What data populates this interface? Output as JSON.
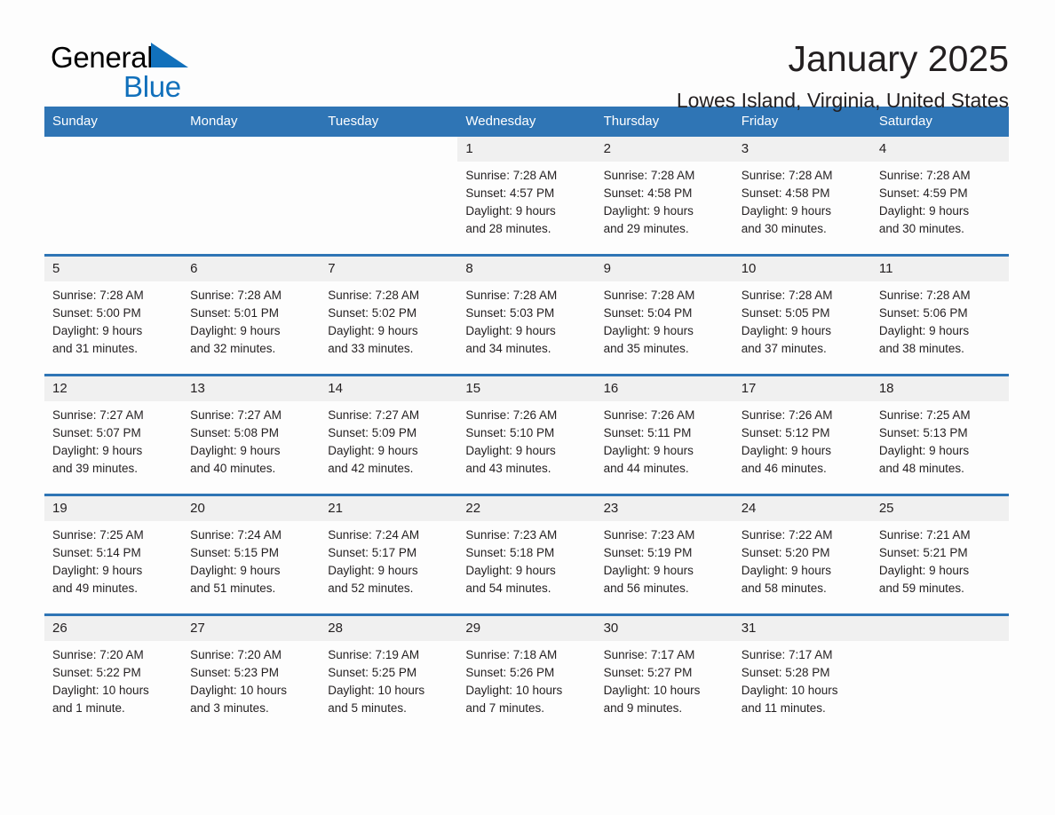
{
  "brand": {
    "name_part1": "General",
    "name_part2": "Blue",
    "triangle_color": "#1170bb",
    "blue_color": "#1170bb"
  },
  "header": {
    "title": "January 2025",
    "subtitle": "Lowes Island, Virginia, United States"
  },
  "theme": {
    "header_blue": "#2f75b5",
    "daynum_strip": "#f0f0f0",
    "page_background": "#fdfdfd",
    "text_color": "#231f20"
  },
  "weekday_headers": [
    "Sunday",
    "Monday",
    "Tuesday",
    "Wednesday",
    "Thursday",
    "Friday",
    "Saturday"
  ],
  "weeks": [
    [
      {
        "day": "",
        "blank": true,
        "void": true,
        "sunrise": "",
        "sunset": "",
        "daylight_line1": "",
        "daylight_line2": ""
      },
      {
        "day": "",
        "blank": true,
        "void": true,
        "sunrise": "",
        "sunset": "",
        "daylight_line1": "",
        "daylight_line2": ""
      },
      {
        "day": "",
        "blank": true,
        "void": true,
        "sunrise": "",
        "sunset": "",
        "daylight_line1": "",
        "daylight_line2": ""
      },
      {
        "day": "1",
        "sunrise": "Sunrise: 7:28 AM",
        "sunset": "Sunset: 4:57 PM",
        "daylight_line1": "Daylight: 9 hours",
        "daylight_line2": "and 28 minutes."
      },
      {
        "day": "2",
        "sunrise": "Sunrise: 7:28 AM",
        "sunset": "Sunset: 4:58 PM",
        "daylight_line1": "Daylight: 9 hours",
        "daylight_line2": "and 29 minutes."
      },
      {
        "day": "3",
        "sunrise": "Sunrise: 7:28 AM",
        "sunset": "Sunset: 4:58 PM",
        "daylight_line1": "Daylight: 9 hours",
        "daylight_line2": "and 30 minutes."
      },
      {
        "day": "4",
        "sunrise": "Sunrise: 7:28 AM",
        "sunset": "Sunset: 4:59 PM",
        "daylight_line1": "Daylight: 9 hours",
        "daylight_line2": "and 30 minutes."
      }
    ],
    [
      {
        "day": "5",
        "sunrise": "Sunrise: 7:28 AM",
        "sunset": "Sunset: 5:00 PM",
        "daylight_line1": "Daylight: 9 hours",
        "daylight_line2": "and 31 minutes."
      },
      {
        "day": "6",
        "sunrise": "Sunrise: 7:28 AM",
        "sunset": "Sunset: 5:01 PM",
        "daylight_line1": "Daylight: 9 hours",
        "daylight_line2": "and 32 minutes."
      },
      {
        "day": "7",
        "sunrise": "Sunrise: 7:28 AM",
        "sunset": "Sunset: 5:02 PM",
        "daylight_line1": "Daylight: 9 hours",
        "daylight_line2": "and 33 minutes."
      },
      {
        "day": "8",
        "sunrise": "Sunrise: 7:28 AM",
        "sunset": "Sunset: 5:03 PM",
        "daylight_line1": "Daylight: 9 hours",
        "daylight_line2": "and 34 minutes."
      },
      {
        "day": "9",
        "sunrise": "Sunrise: 7:28 AM",
        "sunset": "Sunset: 5:04 PM",
        "daylight_line1": "Daylight: 9 hours",
        "daylight_line2": "and 35 minutes."
      },
      {
        "day": "10",
        "sunrise": "Sunrise: 7:28 AM",
        "sunset": "Sunset: 5:05 PM",
        "daylight_line1": "Daylight: 9 hours",
        "daylight_line2": "and 37 minutes."
      },
      {
        "day": "11",
        "sunrise": "Sunrise: 7:28 AM",
        "sunset": "Sunset: 5:06 PM",
        "daylight_line1": "Daylight: 9 hours",
        "daylight_line2": "and 38 minutes."
      }
    ],
    [
      {
        "day": "12",
        "sunrise": "Sunrise: 7:27 AM",
        "sunset": "Sunset: 5:07 PM",
        "daylight_line1": "Daylight: 9 hours",
        "daylight_line2": "and 39 minutes."
      },
      {
        "day": "13",
        "sunrise": "Sunrise: 7:27 AM",
        "sunset": "Sunset: 5:08 PM",
        "daylight_line1": "Daylight: 9 hours",
        "daylight_line2": "and 40 minutes."
      },
      {
        "day": "14",
        "sunrise": "Sunrise: 7:27 AM",
        "sunset": "Sunset: 5:09 PM",
        "daylight_line1": "Daylight: 9 hours",
        "daylight_line2": "and 42 minutes."
      },
      {
        "day": "15",
        "sunrise": "Sunrise: 7:26 AM",
        "sunset": "Sunset: 5:10 PM",
        "daylight_line1": "Daylight: 9 hours",
        "daylight_line2": "and 43 minutes."
      },
      {
        "day": "16",
        "sunrise": "Sunrise: 7:26 AM",
        "sunset": "Sunset: 5:11 PM",
        "daylight_line1": "Daylight: 9 hours",
        "daylight_line2": "and 44 minutes."
      },
      {
        "day": "17",
        "sunrise": "Sunrise: 7:26 AM",
        "sunset": "Sunset: 5:12 PM",
        "daylight_line1": "Daylight: 9 hours",
        "daylight_line2": "and 46 minutes."
      },
      {
        "day": "18",
        "sunrise": "Sunrise: 7:25 AM",
        "sunset": "Sunset: 5:13 PM",
        "daylight_line1": "Daylight: 9 hours",
        "daylight_line2": "and 48 minutes."
      }
    ],
    [
      {
        "day": "19",
        "sunrise": "Sunrise: 7:25 AM",
        "sunset": "Sunset: 5:14 PM",
        "daylight_line1": "Daylight: 9 hours",
        "daylight_line2": "and 49 minutes."
      },
      {
        "day": "20",
        "sunrise": "Sunrise: 7:24 AM",
        "sunset": "Sunset: 5:15 PM",
        "daylight_line1": "Daylight: 9 hours",
        "daylight_line2": "and 51 minutes."
      },
      {
        "day": "21",
        "sunrise": "Sunrise: 7:24 AM",
        "sunset": "Sunset: 5:17 PM",
        "daylight_line1": "Daylight: 9 hours",
        "daylight_line2": "and 52 minutes."
      },
      {
        "day": "22",
        "sunrise": "Sunrise: 7:23 AM",
        "sunset": "Sunset: 5:18 PM",
        "daylight_line1": "Daylight: 9 hours",
        "daylight_line2": "and 54 minutes."
      },
      {
        "day": "23",
        "sunrise": "Sunrise: 7:23 AM",
        "sunset": "Sunset: 5:19 PM",
        "daylight_line1": "Daylight: 9 hours",
        "daylight_line2": "and 56 minutes."
      },
      {
        "day": "24",
        "sunrise": "Sunrise: 7:22 AM",
        "sunset": "Sunset: 5:20 PM",
        "daylight_line1": "Daylight: 9 hours",
        "daylight_line2": "and 58 minutes."
      },
      {
        "day": "25",
        "sunrise": "Sunrise: 7:21 AM",
        "sunset": "Sunset: 5:21 PM",
        "daylight_line1": "Daylight: 9 hours",
        "daylight_line2": "and 59 minutes."
      }
    ],
    [
      {
        "day": "26",
        "sunrise": "Sunrise: 7:20 AM",
        "sunset": "Sunset: 5:22 PM",
        "daylight_line1": "Daylight: 10 hours",
        "daylight_line2": "and 1 minute."
      },
      {
        "day": "27",
        "sunrise": "Sunrise: 7:20 AM",
        "sunset": "Sunset: 5:23 PM",
        "daylight_line1": "Daylight: 10 hours",
        "daylight_line2": "and 3 minutes."
      },
      {
        "day": "28",
        "sunrise": "Sunrise: 7:19 AM",
        "sunset": "Sunset: 5:25 PM",
        "daylight_line1": "Daylight: 10 hours",
        "daylight_line2": "and 5 minutes."
      },
      {
        "day": "29",
        "sunrise": "Sunrise: 7:18 AM",
        "sunset": "Sunset: 5:26 PM",
        "daylight_line1": "Daylight: 10 hours",
        "daylight_line2": "and 7 minutes."
      },
      {
        "day": "30",
        "sunrise": "Sunrise: 7:17 AM",
        "sunset": "Sunset: 5:27 PM",
        "daylight_line1": "Daylight: 10 hours",
        "daylight_line2": "and 9 minutes."
      },
      {
        "day": "31",
        "sunrise": "Sunrise: 7:17 AM",
        "sunset": "Sunset: 5:28 PM",
        "daylight_line1": "Daylight: 10 hours",
        "daylight_line2": "and 11 minutes."
      },
      {
        "day": "",
        "blank": true,
        "sunrise": "",
        "sunset": "",
        "daylight_line1": "",
        "daylight_line2": ""
      }
    ]
  ]
}
